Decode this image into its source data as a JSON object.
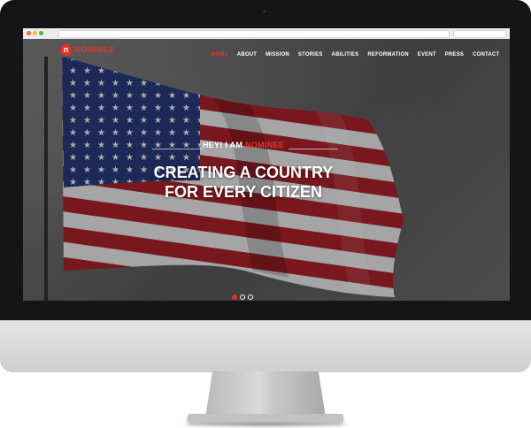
{
  "site": {
    "logo_mark": "n",
    "logo_text": "NOMINEE"
  },
  "nav": {
    "items": [
      {
        "label": "HOME",
        "active": true
      },
      {
        "label": "ABOUT",
        "active": false
      },
      {
        "label": "MISSION",
        "active": false
      },
      {
        "label": "STORIES",
        "active": false
      },
      {
        "label": "ABILITIES",
        "active": false
      },
      {
        "label": "REFORMATION",
        "active": false
      },
      {
        "label": "EVENT",
        "active": false
      },
      {
        "label": "PRESS",
        "active": false
      },
      {
        "label": "CONTACT",
        "active": false
      }
    ]
  },
  "hero": {
    "eyebrow_prefix": "HEY! I AM ",
    "eyebrow_name": "NOMINEE",
    "headline_line1": "CREATING A COUNTRY",
    "headline_line2": "FOR EVERY CITIZEN",
    "background": "american-flag-image"
  },
  "slider": {
    "slide_count": 3,
    "active_slide": 1
  },
  "colors": {
    "accent": "#e2332a",
    "bezel": "#151515",
    "chin": "#dcdcdc"
  },
  "icons": {
    "window_controls": [
      "close-dot",
      "minimize-dot",
      "maximize-dot"
    ],
    "logo": "nominee-logo-icon"
  }
}
